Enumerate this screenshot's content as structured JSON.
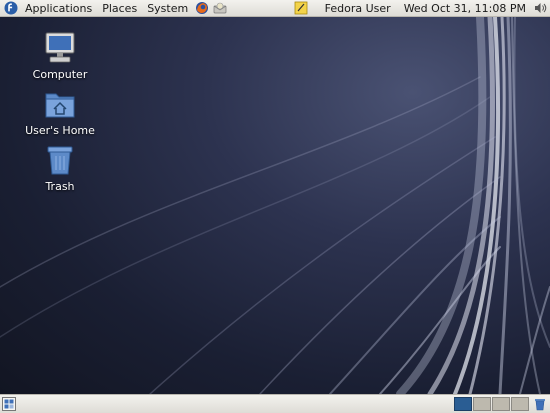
{
  "top_panel": {
    "menus": [
      "Applications",
      "Places",
      "System"
    ],
    "launchers": [
      "firefox-icon",
      "mail-client-icon"
    ],
    "notes_icon": "notes-icon",
    "user": "Fedora User",
    "clock": "Wed Oct 31, 11:08 PM",
    "volume_icon": "volume-icon"
  },
  "desktop": {
    "icons": [
      {
        "label": "Computer",
        "icon": "computer-icon"
      },
      {
        "label": "User's Home",
        "icon": "home-folder-icon"
      },
      {
        "label": "Trash",
        "icon": "trash-icon"
      }
    ]
  },
  "bottom_panel": {
    "show_desktop_icon": "show-desktop-icon",
    "workspaces": 4,
    "active_workspace": 1
  },
  "colors": {
    "panel": "#e6e4de",
    "desktop": "#1b2033",
    "workspace_active": "#2a5d93",
    "fedora_logo": "#2a5ea8"
  }
}
